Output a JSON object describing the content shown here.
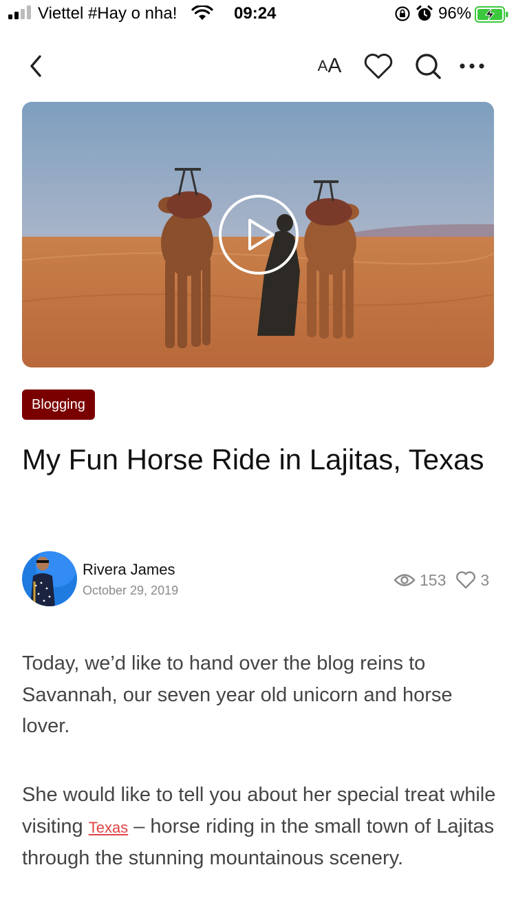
{
  "status_bar": {
    "carrier": "Viettel #Hay o nha!",
    "time": "09:24",
    "battery_percent": "96%",
    "signal_icon": "signal-icon",
    "wifi_icon": "wifi-icon",
    "battery_icon": "battery-charging-icon"
  },
  "nav": {
    "font_size_label_small": "A",
    "font_size_label_large": "A",
    "icons": [
      "chevron-left-icon",
      "text-size-icon",
      "heart-icon",
      "search-icon",
      "more-icon"
    ]
  },
  "hero": {
    "play_icon": "play-icon"
  },
  "article": {
    "category": "Blogging",
    "title": "My Fun Horse Ride in Lajitas, Texas",
    "author": {
      "name": "Rivera James",
      "date": "October 29, 2019"
    },
    "stats": {
      "views": "153",
      "likes": "3"
    },
    "paragraphs": {
      "p1": "Today, we’d like to hand over the blog reins to Savannah, our seven year old unicorn and horse lover.",
      "p2_before_link": "She would like to tell you about her special treat while visiting ",
      "p2_link": "Texas",
      "p2_after_link": " – horse riding in the small town of Lajitas through the stunning mountainous scenery."
    },
    "accent_color": "#7a0000",
    "link_color": "#e04444"
  }
}
